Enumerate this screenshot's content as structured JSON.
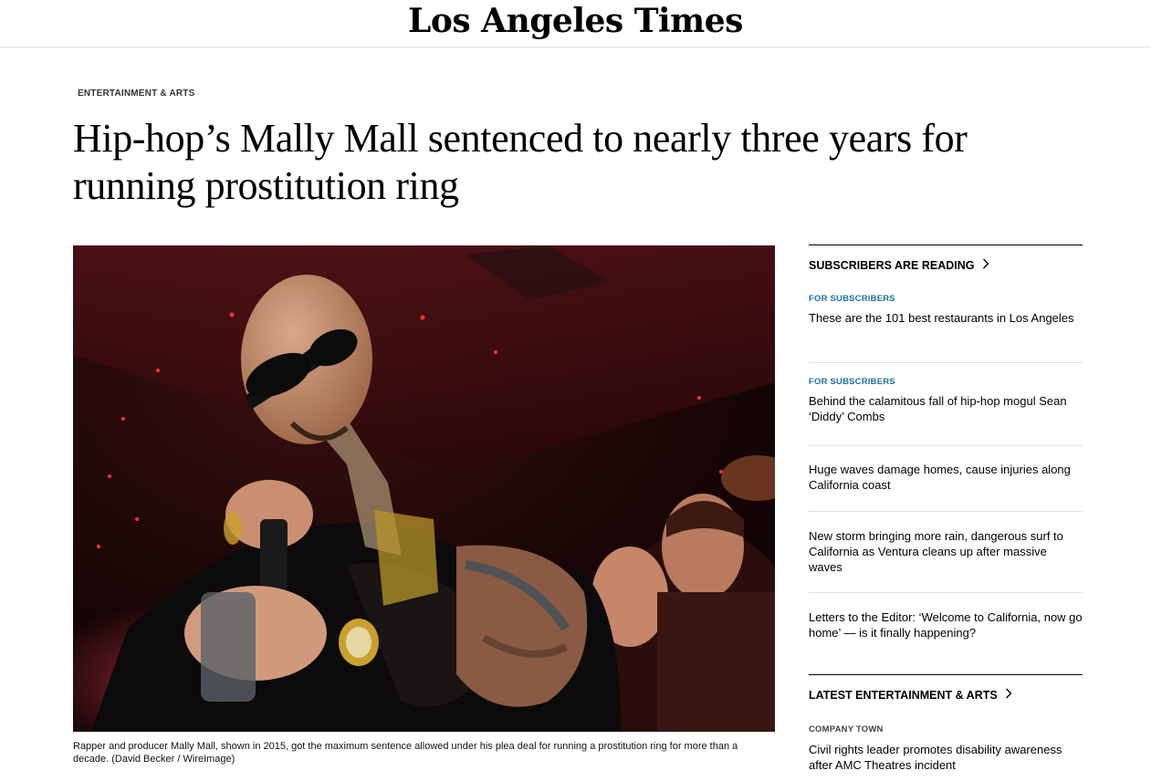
{
  "masthead": {
    "logo_text": "Los Angeles Times"
  },
  "article": {
    "section": "ENTERTAINMENT & ARTS",
    "headline": "Hip-hop’s Mally Mall sentenced to nearly three years for running prostitution ring",
    "caption": "Rapper and producer Mally Mall, shown in 2015, got the maximum sentence allowed under his plea deal for running a prostitution ring for more than a decade.",
    "credit": "(David Becker / WireImage)"
  },
  "sidebar": {
    "subscribers_heading": "SUBSCRIBERS ARE READING",
    "subscribers_items": [
      {
        "kicker": "FOR SUBSCRIBERS",
        "title": "These are the 101 best restaurants in Los Angeles"
      },
      {
        "kicker": "FOR SUBSCRIBERS",
        "title": "Behind the calamitous fall of hip-hop mogul Sean ‘Diddy’ Combs"
      },
      {
        "kicker": "",
        "title": "Huge waves damage homes, cause injuries along California coast"
      },
      {
        "kicker": "",
        "title": "New storm bringing more rain, dangerous surf to California as Ventura cleans up after massive waves"
      },
      {
        "kicker": "",
        "title": "Letters to the Editor: ‘Welcome to California, now go home’ — is it finally happening?"
      }
    ],
    "latest_heading": "LATEST ENTERTAINMENT & ARTS",
    "latest_items": [
      {
        "kicker": "COMPANY TOWN",
        "title": "Civil rights leader promotes disability awareness after AMC Theatres incident"
      }
    ]
  },
  "colors": {
    "kicker_blue": "#1e6fa0",
    "divider": "#e3e3e3"
  }
}
